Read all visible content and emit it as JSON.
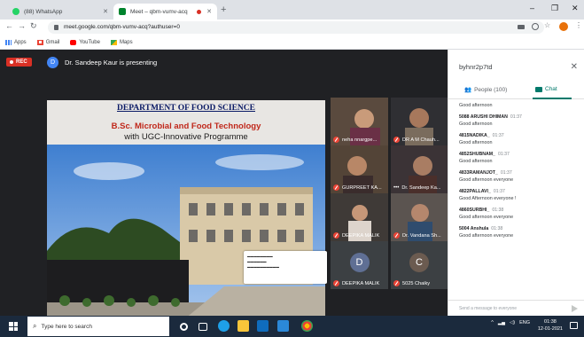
{
  "browser": {
    "tabs": [
      {
        "title": "(88) WhatsApp",
        "favicon": "whatsapp-icon",
        "color": "#25d366"
      },
      {
        "title": "Meet – qbm-vumv-acq",
        "favicon": "meet-icon",
        "color": "#00832d"
      }
    ],
    "address": "meet.google.com/qbm-vumv-acq?authuser=0",
    "bookmarks": [
      {
        "label": "Apps",
        "icon": "apps-grid-icon"
      },
      {
        "label": "Gmail",
        "icon": "gmail-icon"
      },
      {
        "label": "YouTube",
        "icon": "youtube-icon"
      },
      {
        "label": "Maps",
        "icon": "maps-icon"
      }
    ]
  },
  "meet": {
    "rec_label": "REC",
    "presenter_initial": "D",
    "presenter_text": "Dr. Sandeep Kaur is presenting",
    "slide": {
      "title": "DEPARTMENT OF FOOD SCIENCE",
      "subtitle": "B.Sc. Microbial and Food Technology",
      "subtitle2": "with UGC-Innovative Programme"
    },
    "participants": [
      {
        "name": "neha nnargpe...",
        "muted": true
      },
      {
        "name": "DR A M Chauh...",
        "muted": true
      },
      {
        "name": "GURPREET KA...",
        "muted": true
      },
      {
        "name": "Dr. Sandeep Ka...",
        "muted": false
      },
      {
        "name": "DEEPIKA MALIK",
        "muted": true
      },
      {
        "name": "Dr. Vandana Sh...",
        "muted": true
      },
      {
        "name": "DEEPIKA MALIK",
        "muted": true,
        "letter": "D",
        "color": "#5f6f94"
      },
      {
        "name": "5025 Chaiky",
        "muted": true,
        "letter": "C",
        "color": "#6b5b50"
      }
    ]
  },
  "chat": {
    "meeting_code": "byhnr2p7td",
    "people_tab": "People (100)",
    "chat_tab": "Chat",
    "messages": [
      {
        "sender": "",
        "time": "",
        "text": "Good afternoon"
      },
      {
        "sender": "5088 ARUSHI DHIMAN",
        "time": "01:37",
        "text": "Good afternoon"
      },
      {
        "sender": "4815NADIKA_",
        "time": "01:37",
        "text": "Good afternoon"
      },
      {
        "sender": "4852SHUBNAM_",
        "time": "01:37",
        "text": "Good afternoon"
      },
      {
        "sender": "4833RAMANJOT_",
        "time": "01:37",
        "text": "Good afternoon everyone"
      },
      {
        "sender": "4822PALLAVI_",
        "time": "01:37",
        "text": "Good Afternoon everyone !"
      },
      {
        "sender": "4860SURBHI_",
        "time": "01:38",
        "text": "Good afternoon everyone"
      },
      {
        "sender": "5004 Anshula",
        "time": "01:38",
        "text": "Good afternoon everyone"
      }
    ],
    "input_placeholder": "Send a message to everyone"
  },
  "taskbar": {
    "search_placeholder": "Type here to search",
    "tray_lang": "ENG",
    "time": "01:38",
    "date": "12-01-2021"
  }
}
